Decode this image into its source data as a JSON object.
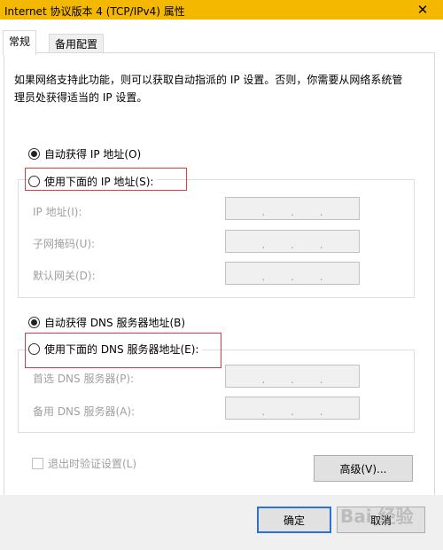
{
  "window": {
    "title": "Internet 协议版本 4 (TCP/IPv4) 属性",
    "close_glyph": "✕"
  },
  "tabs": [
    {
      "label": "常规",
      "selected": true
    },
    {
      "label": "备用配置",
      "selected": false
    }
  ],
  "description": "如果网络支持此功能，则可以获取自动指派的 IP 设置。否则，你需要从网络系统管理员处获得适当的 IP 设置。",
  "ip": {
    "auto_label": "自动获得 IP 地址(O)",
    "manual_label": "使用下面的 IP 地址(S):",
    "auto_selected": true,
    "fields": [
      {
        "label": "IP 地址(I):",
        "dots": [
          ".",
          ".",
          "."
        ]
      },
      {
        "label": "子网掩码(U):",
        "dots": [
          ".",
          ".",
          "."
        ]
      },
      {
        "label": "默认网关(D):",
        "dots": [
          ".",
          ".",
          "."
        ]
      }
    ]
  },
  "dns": {
    "auto_label": "自动获得 DNS 服务器地址(B)",
    "manual_label": "使用下面的 DNS 服务器地址(E):",
    "auto_selected": true,
    "fields": [
      {
        "label": "首选 DNS 服务器(P):",
        "dots": [
          ".",
          ".",
          "."
        ]
      },
      {
        "label": "备用 DNS 服务器(A):",
        "dots": [
          ".",
          ".",
          "."
        ]
      }
    ]
  },
  "validate_label": "退出时验证设置(L)",
  "advanced_label": "高级(V)...",
  "ok_label": "确定",
  "cancel_label": "取消",
  "watermark": "Bai 经验",
  "colors": {
    "titlebar": "#f5b800",
    "highlight_box": "#e0393e",
    "default_button_border": "#2b73d2"
  }
}
